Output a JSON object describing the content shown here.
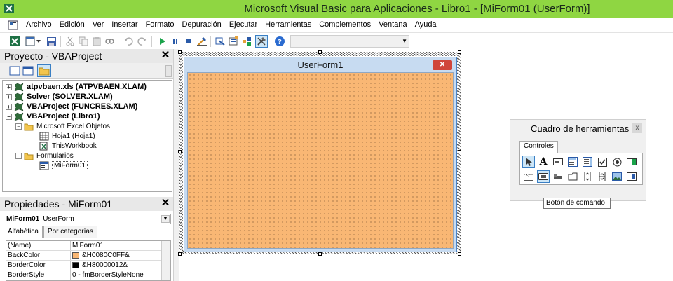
{
  "window": {
    "title": "Microsoft Visual Basic para Aplicaciones - Libro1 - [MiForm01 (UserForm)]",
    "accent_color": "#8fd642"
  },
  "menu": {
    "items": [
      "Archivo",
      "Edición",
      "Ver",
      "Insertar",
      "Formato",
      "Depuración",
      "Ejecutar",
      "Herramientas",
      "Complementos",
      "Ventana",
      "Ayuda"
    ]
  },
  "toolbar": {
    "icons": [
      "excel-icon",
      "insert-userform-icon",
      "save-icon",
      "cut-icon",
      "copy-icon",
      "paste-icon",
      "find-icon",
      "undo-icon",
      "redo-icon",
      "run-icon",
      "pause-icon",
      "stop-icon",
      "design-mode-icon",
      "project-explorer-icon",
      "properties-icon",
      "object-browser-icon",
      "toolbox-icon",
      "help-icon"
    ]
  },
  "project": {
    "title": "Proyecto - VBAProject",
    "close": "✕",
    "tree": [
      {
        "label": "atpvbaen.xls (ATPVBAEN.XLAM)",
        "level": 0,
        "bold": true,
        "expander": "+"
      },
      {
        "label": "Solver (SOLVER.XLAM)",
        "level": 0,
        "bold": true,
        "expander": "+"
      },
      {
        "label": "VBAProject (FUNCRES.XLAM)",
        "level": 0,
        "bold": true,
        "expander": "+"
      },
      {
        "label": "VBAProject (Libro1)",
        "level": 0,
        "bold": true,
        "expander": "−"
      },
      {
        "label": "Microsoft Excel Objetos",
        "level": 1,
        "bold": false,
        "expander": "−"
      },
      {
        "label": "Hoja1 (Hoja1)",
        "level": 2,
        "bold": false,
        "expander": ""
      },
      {
        "label": "ThisWorkbook",
        "level": 2,
        "bold": false,
        "expander": ""
      },
      {
        "label": "Formularios",
        "level": 1,
        "bold": false,
        "expander": "−"
      },
      {
        "label": "MiForm01",
        "level": 2,
        "bold": false,
        "expander": ""
      }
    ]
  },
  "properties": {
    "title": "Propiedades - MiForm01",
    "close": "✕",
    "object_name": "MiForm01",
    "object_type": "UserForm",
    "tabs": [
      "Alfabética",
      "Por categorías"
    ],
    "rows": [
      {
        "key": "(Name)",
        "value": "MiForm01",
        "swatch": ""
      },
      {
        "key": "BackColor",
        "value": "&H0080C0FF&",
        "swatch": "#f9b774"
      },
      {
        "key": "BorderColor",
        "value": "&H80000012&",
        "swatch": "#000000"
      },
      {
        "key": "BorderStyle",
        "value": "0 - fmBorderStyleNone",
        "swatch": ""
      }
    ]
  },
  "userform": {
    "caption": "UserForm1",
    "close": "✕",
    "back_color": "#f9b774"
  },
  "toolbox": {
    "title": "Cuadro de herramientas",
    "close": "x",
    "tab": "Controles",
    "tooltip": "Botón de comando"
  }
}
